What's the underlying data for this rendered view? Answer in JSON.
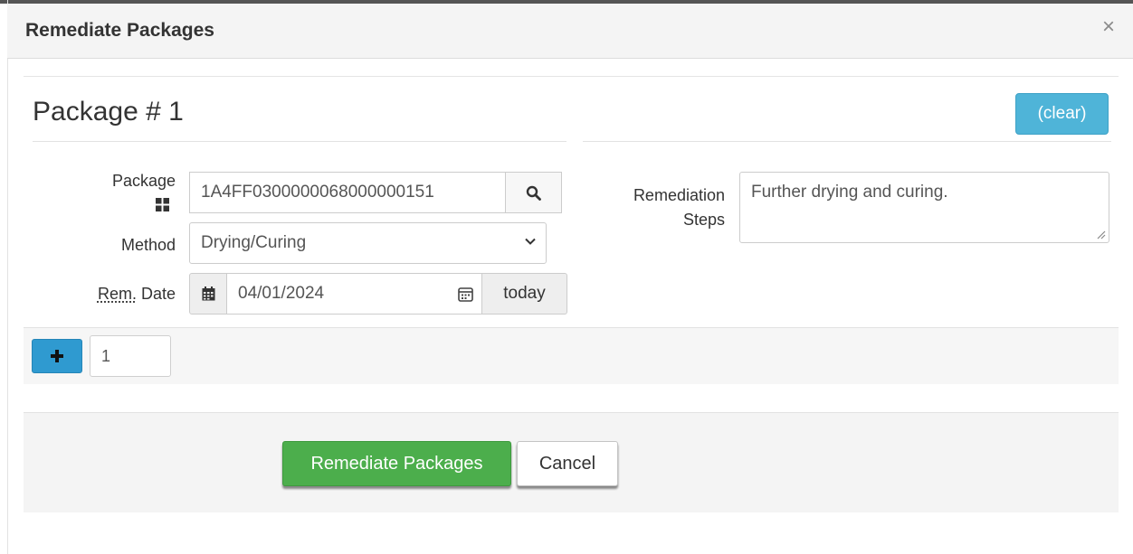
{
  "dialog": {
    "title": "Remediate Packages",
    "close_label": "×"
  },
  "package_section": {
    "heading": "Package # 1",
    "clear_label": "(clear)",
    "package_label": "Package",
    "package_value": "1A4FF0300000068000000151",
    "method_label": "Method",
    "method_value": "Drying/Curing",
    "rem_date_label_abbr": "Rem.",
    "rem_date_label_rest": " Date",
    "rem_date_value": "04/01/2024",
    "today_label": "today",
    "steps_label_line1": "Remediation",
    "steps_label_line2": "Steps",
    "steps_value": "Further drying and curing."
  },
  "add_row": {
    "count_value": "1"
  },
  "footer": {
    "submit_label": "Remediate Packages",
    "cancel_label": "Cancel"
  },
  "colors": {
    "info_button": "#4fb4d8",
    "primary_button": "#4cae4c",
    "plus_button": "#2f9ad0"
  },
  "icons": [
    "close-icon",
    "barcode-grid-icon",
    "search-icon",
    "chevron-down-icon",
    "calendar-icon",
    "date-picker-icon",
    "plus-icon"
  ]
}
